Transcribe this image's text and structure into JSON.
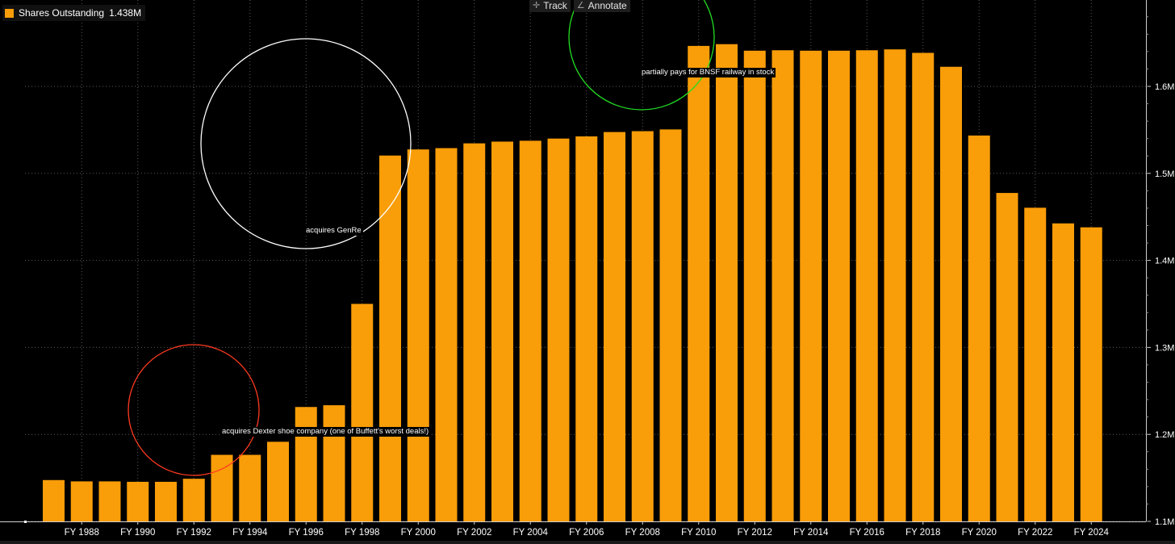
{
  "legend": {
    "label": "Shares Outstanding",
    "value": "1.438M",
    "color": "#f99d08"
  },
  "toolbar": [
    {
      "label": "Track",
      "icon": "crosshair-icon",
      "glyph": "✛"
    },
    {
      "label": "Annotate",
      "icon": "pencil-icon",
      "glyph": "∠"
    }
  ],
  "annotations": [
    {
      "text": "acquires Dexter shoe company (one of Buffett's worst deals!)",
      "color": "#ff3b1f"
    },
    {
      "text": "acquires GenRe",
      "color": "#ffffff"
    },
    {
      "text": "partially pays for BNSF railway in stock",
      "color": "#22dd22"
    }
  ],
  "chart_data": {
    "type": "bar",
    "x": [
      "FY 1987",
      "FY 1988",
      "FY 1989",
      "FY 1990",
      "FY 1991",
      "FY 1992",
      "FY 1993",
      "FY 1994",
      "FY 1995",
      "FY 1996",
      "FY 1997",
      "FY 1998",
      "FY 1999",
      "FY 2000",
      "FY 2001",
      "FY 2002",
      "FY 2003",
      "FY 2004",
      "FY 2005",
      "FY 2006",
      "FY 2007",
      "FY 2008",
      "FY 2009",
      "FY 2010",
      "FY 2011",
      "FY 2012",
      "FY 2013",
      "FY 2014",
      "FY 2015",
      "FY 2016",
      "FY 2017",
      "FY 2018",
      "FY 2019",
      "FY 2020",
      "FY 2021",
      "FY 2022",
      "FY 2023",
      "FY 2024"
    ],
    "x_tick_labels": [
      "FY 1988",
      "FY 1990",
      "FY 1992",
      "FY 1994",
      "FY 1996",
      "FY 1998",
      "FY 2000",
      "FY 2002",
      "FY 2004",
      "FY 2006",
      "FY 2008",
      "FY 2010",
      "FY 2012",
      "FY 2014",
      "FY 2016",
      "FY 2018",
      "FY 2020",
      "FY 2022",
      "FY 2024"
    ],
    "series": [
      {
        "name": "Shares Outstanding",
        "values": [
          1.1475,
          1.146,
          1.146,
          1.1455,
          1.1455,
          1.149,
          1.1765,
          1.1765,
          1.1915,
          1.2315,
          1.2335,
          1.35,
          1.5205,
          1.5275,
          1.529,
          1.5345,
          1.5365,
          1.5375,
          1.54,
          1.5425,
          1.5475,
          1.5485,
          1.5505,
          1.6465,
          1.6485,
          1.641,
          1.6415,
          1.641,
          1.641,
          1.6415,
          1.6425,
          1.6385,
          1.6225,
          1.5435,
          1.4775,
          1.4605,
          1.4425,
          1.438
        ]
      }
    ],
    "ylim": [
      1.1,
      1.7
    ],
    "yticks": [
      "1.1M",
      "1.2M",
      "1.3M",
      "1.4M",
      "1.5M",
      "1.6M"
    ],
    "ytick_values": [
      1.1,
      1.2,
      1.3,
      1.4,
      1.5,
      1.6
    ],
    "grid": true,
    "color": "#f99d08",
    "background": "#000000"
  }
}
